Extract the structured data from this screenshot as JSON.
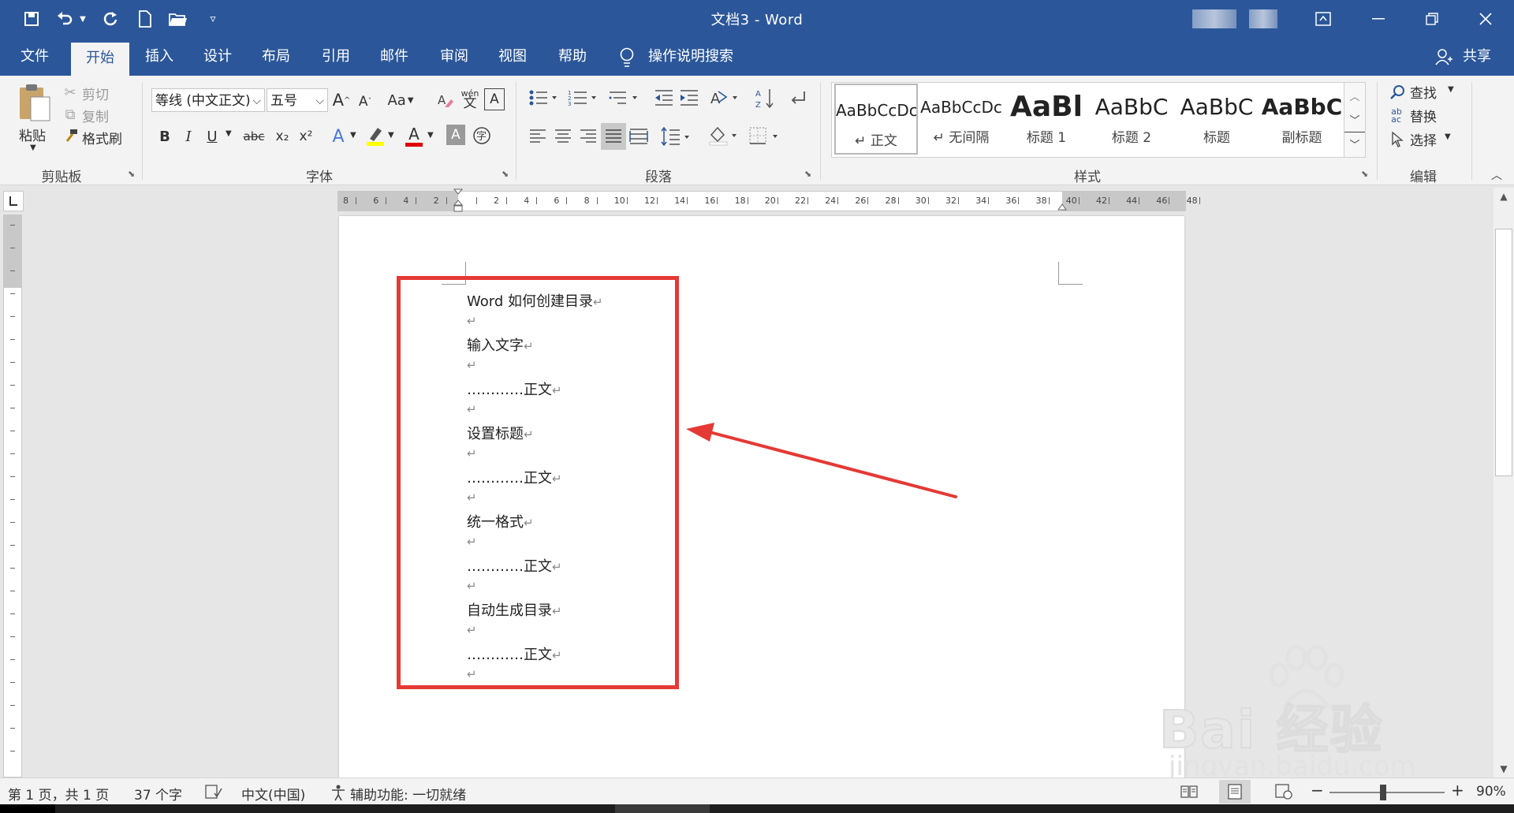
{
  "window": {
    "title": "文档3 - Word"
  },
  "tabs": [
    "文件",
    "开始",
    "插入",
    "设计",
    "布局",
    "引用",
    "邮件",
    "审阅",
    "视图",
    "帮助"
  ],
  "tell_me": "操作说明搜索",
  "share": "共享",
  "clipboard": {
    "paste": "粘贴",
    "cut": "剪切",
    "copy": "复制",
    "format_painter": "格式刷",
    "label": "剪贴板"
  },
  "font": {
    "name": "等线 (中文正文)",
    "size": "五号",
    "change_case": "Aa",
    "bold": "B",
    "italic": "I",
    "underline": "U",
    "strike": "abc",
    "sub": "x₂",
    "sup": "x²",
    "label": "字体",
    "phonetic": "wén"
  },
  "paragraph": {
    "label": "段落"
  },
  "styles": {
    "label": "样式",
    "items": [
      {
        "sample": "AaBbCcDc",
        "name": "↵ 正文"
      },
      {
        "sample": "AaBbCcDc",
        "name": "↵ 无间隔"
      },
      {
        "sample": "AaBl",
        "name": "标题 1"
      },
      {
        "sample": "AaBbC",
        "name": "标题 2"
      },
      {
        "sample": "AaBbC",
        "name": "标题"
      },
      {
        "sample": "AaBbC",
        "name": "副标题"
      }
    ]
  },
  "editing": {
    "find": "查找",
    "replace": "替换",
    "select": "选择",
    "label": "编辑"
  },
  "ruler": [
    "8",
    "6",
    "4",
    "2",
    "",
    "2",
    "4",
    "6",
    "8",
    "10",
    "12",
    "14",
    "16",
    "18",
    "20",
    "22",
    "24",
    "26",
    "28",
    "30",
    "32",
    "34",
    "36",
    "38",
    "40",
    "42",
    "44",
    "46",
    "48"
  ],
  "document": {
    "lines": [
      {
        "text": "Word 如何创建目录",
        "mark": "↵"
      },
      {
        "text": "",
        "mark": "↵"
      },
      {
        "text": "输入文字",
        "mark": "↵"
      },
      {
        "text": "",
        "mark": "↵"
      },
      {
        "text": "…………正文",
        "mark": "↵"
      },
      {
        "text": "",
        "mark": "↵"
      },
      {
        "text": "设置标题",
        "mark": "↵"
      },
      {
        "text": "",
        "mark": "↵"
      },
      {
        "text": "…………正文",
        "mark": "↵"
      },
      {
        "text": "",
        "mark": "↵"
      },
      {
        "text": "统一格式",
        "mark": "↵"
      },
      {
        "text": "",
        "mark": "↵"
      },
      {
        "text": "…………正文",
        "mark": "↵"
      },
      {
        "text": "",
        "mark": "↵"
      },
      {
        "text": "自动生成目录",
        "mark": "↵"
      },
      {
        "text": "",
        "mark": "↵"
      },
      {
        "text": "…………正文",
        "mark": "↵"
      },
      {
        "text": "",
        "mark": "↵"
      }
    ]
  },
  "status": {
    "page": "第 1 页，共 1 页",
    "words": "37 个字",
    "lang": "中文(中国)",
    "accessibility": "辅助功能: 一切就绪",
    "zoom": "90%"
  },
  "watermark": {
    "brand": "Bai 经验",
    "url": "jingyan.baidu.com"
  },
  "colors": {
    "brand": "#2b579a",
    "highlight": "#e53935"
  }
}
